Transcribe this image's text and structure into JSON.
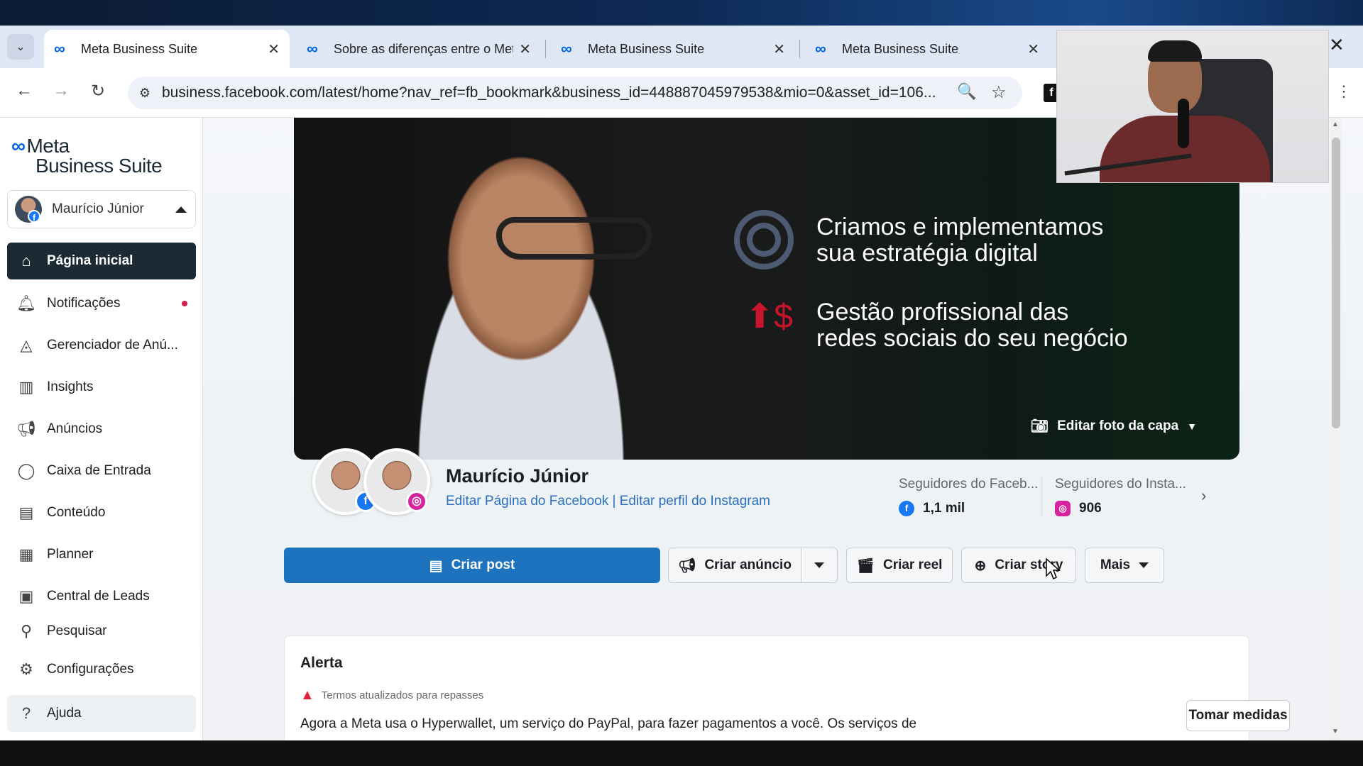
{
  "browser": {
    "tabs": [
      {
        "title": "Meta Business Suite",
        "active": true
      },
      {
        "title": "Sobre as diferenças entre o Met",
        "active": false
      },
      {
        "title": "Meta Business Suite",
        "active": false
      },
      {
        "title": "Meta Business Suite",
        "active": false
      }
    ],
    "url": "business.facebook.com/latest/home?nav_ref=fb_bookmark&business_id=448887045979538&mio=0&asset_id=106..."
  },
  "sidebar": {
    "brand_line1": "Meta",
    "brand_line2": "Business Suite",
    "account_name": "Maurício Júnior",
    "items": [
      {
        "label": "Página inicial",
        "icon": "home-icon"
      },
      {
        "label": "Notificações",
        "icon": "bell-icon"
      },
      {
        "label": "Gerenciador de Anú...",
        "icon": "ads-manager-icon"
      },
      {
        "label": "Insights",
        "icon": "bar-chart-icon"
      },
      {
        "label": "Anúncios",
        "icon": "megaphone-icon"
      },
      {
        "label": "Caixa de Entrada",
        "icon": "chat-icon"
      },
      {
        "label": "Conteúdo",
        "icon": "content-icon"
      },
      {
        "label": "Planner",
        "icon": "calendar-icon"
      },
      {
        "label": "Central de Leads",
        "icon": "leads-icon"
      },
      {
        "label": "Pesquisar",
        "icon": "search-icon"
      },
      {
        "label": "Configurações",
        "icon": "gear-icon"
      },
      {
        "label": "Ajuda",
        "icon": "help-icon"
      }
    ]
  },
  "cover": {
    "tagline1_line1": "Criamos e implementamos",
    "tagline1_line2": "sua estratégia digital",
    "tagline2_line1": "Gestão profissional das",
    "tagline2_line2": "redes sociais do seu negócio",
    "edit_label": "Editar foto da capa"
  },
  "profile": {
    "name": "Maurício Júnior",
    "edit_fb": "Editar Página do Facebook",
    "separator": "|",
    "edit_ig": "Editar perfil do Instagram",
    "fb_followers_label": "Seguidores do Faceb...",
    "fb_followers_value": "1,1 mil",
    "ig_followers_label": "Seguidores do Insta...",
    "ig_followers_value": "906"
  },
  "actions": {
    "create_post": "Criar post",
    "create_ad": "Criar anúncio",
    "create_reel": "Criar reel",
    "create_story": "Criar story",
    "more": "Mais"
  },
  "alert": {
    "title": "Alerta",
    "subtitle": "Termos atualizados para repasses",
    "body": "Agora a Meta usa o Hyperwallet, um serviço do PayPal, para fazer pagamentos a você. Os serviços de",
    "button": "Tomar medidas"
  },
  "colors": {
    "primary": "#1d73bd",
    "sidebar_active": "#1c2b33",
    "link": "#2a6fc4",
    "facebook": "#1877f2",
    "instagram": "#d6249f",
    "warning": "#e41e3f"
  }
}
